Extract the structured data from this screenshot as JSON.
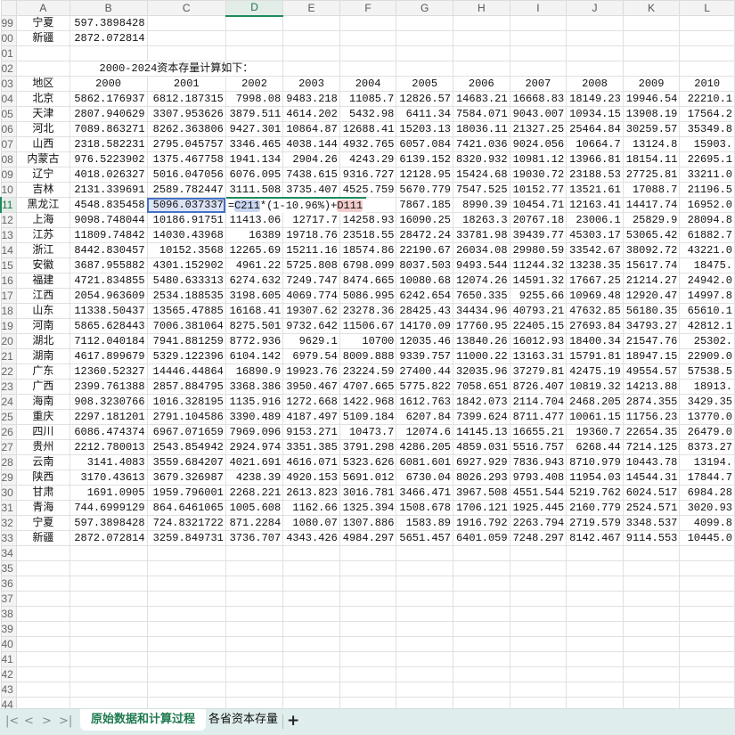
{
  "columns": [
    "A",
    "B",
    "C",
    "D",
    "E",
    "F",
    "G",
    "H",
    "I",
    "J",
    "K",
    "L"
  ],
  "active_column": "D",
  "active_row": "11",
  "rows": [
    {
      "n": "99",
      "cells": [
        "宁夏",
        "597.3898428"
      ]
    },
    {
      "n": "00",
      "cells": [
        "新疆",
        "2872.072814"
      ]
    },
    {
      "n": "01",
      "cells": []
    },
    {
      "n": "02",
      "title": "2000-2024资本存量计算如下："
    },
    {
      "n": "03",
      "cells": [
        "地区",
        "2000",
        "2001",
        "2002",
        "2003",
        "2004",
        "2005",
        "2006",
        "2007",
        "2008",
        "2009",
        "2010"
      ]
    },
    {
      "n": "04",
      "cells": [
        "北京",
        "5862.176937",
        "6812.187315",
        "7998.08",
        "9483.218",
        "11085.7",
        "12826.57",
        "14683.21",
        "16668.83",
        "18149.23",
        "19946.54",
        "22210.1"
      ]
    },
    {
      "n": "05",
      "cells": [
        "天津",
        "2807.940629",
        "3307.953626",
        "3879.511",
        "4614.202",
        "5432.98",
        "6411.34",
        "7584.071",
        "9043.007",
        "10934.15",
        "13908.19",
        "17564.2"
      ]
    },
    {
      "n": "06",
      "cells": [
        "河北",
        "7089.863271",
        "8262.363806",
        "9427.301",
        "10864.87",
        "12688.41",
        "15203.13",
        "18036.11",
        "21327.25",
        "25464.84",
        "30259.57",
        "35349.8"
      ]
    },
    {
      "n": "07",
      "cells": [
        "山西",
        "2318.582231",
        "2795.045757",
        "3346.465",
        "4038.144",
        "4932.765",
        "6057.084",
        "7421.036",
        "9024.056",
        "10664.7",
        "13124.8",
        "15903."
      ]
    },
    {
      "n": "08",
      "cells": [
        "内蒙古",
        "976.5223902",
        "1375.467758",
        "1941.134",
        "2904.26",
        "4243.29",
        "6139.152",
        "8320.932",
        "10981.12",
        "13966.81",
        "18154.11",
        "22695.1"
      ]
    },
    {
      "n": "09",
      "cells": [
        "辽宁",
        "4018.026327",
        "5016.047056",
        "6076.095",
        "7438.615",
        "9316.727",
        "12128.95",
        "15424.68",
        "19030.72",
        "23188.53",
        "27725.81",
        "33211.0"
      ]
    },
    {
      "n": "10",
      "cells": [
        "吉林",
        "2131.339691",
        "2589.782447",
        "3111.508",
        "3735.407",
        "4525.759",
        "5670.779",
        "7547.525",
        "10152.77",
        "13521.61",
        "17088.7",
        "21196.5"
      ]
    },
    {
      "n": "11",
      "cells": [
        "黑龙江",
        "4548.835458",
        "5096.037337",
        "",
        "",
        "",
        "7867.185",
        "8990.39",
        "10454.71",
        "12163.41",
        "14417.74",
        "16952.0"
      ]
    },
    {
      "n": "12",
      "cells": [
        "上海",
        "9098.748044",
        "10186.91751",
        "11413.06",
        "12717.7",
        "14258.93",
        "16090.25",
        "18263.3",
        "20767.18",
        "23006.1",
        "25829.9",
        "28094.8"
      ]
    },
    {
      "n": "13",
      "cells": [
        "江苏",
        "11809.74842",
        "14030.43968",
        "16389",
        "19718.76",
        "23518.55",
        "28472.24",
        "33781.98",
        "39439.77",
        "45303.17",
        "53065.42",
        "61882.7"
      ]
    },
    {
      "n": "14",
      "cells": [
        "浙江",
        "8442.830457",
        "10152.3568",
        "12265.69",
        "15211.16",
        "18574.86",
        "22190.67",
        "26034.08",
        "29980.59",
        "33542.67",
        "38092.72",
        "43221.0"
      ]
    },
    {
      "n": "15",
      "cells": [
        "安徽",
        "3687.955882",
        "4301.152902",
        "4961.22",
        "5725.808",
        "6798.099",
        "8037.503",
        "9493.544",
        "11244.32",
        "13238.35",
        "15617.74",
        "18475."
      ]
    },
    {
      "n": "16",
      "cells": [
        "福建",
        "4721.834855",
        "5480.633313",
        "6274.632",
        "7249.747",
        "8474.665",
        "10080.68",
        "12074.26",
        "14591.32",
        "17667.25",
        "21214.27",
        "24942.0"
      ]
    },
    {
      "n": "17",
      "cells": [
        "江西",
        "2054.963609",
        "2534.188535",
        "3198.605",
        "4069.774",
        "5086.995",
        "6242.654",
        "7650.335",
        "9255.66",
        "10969.48",
        "12920.47",
        "14997.8"
      ]
    },
    {
      "n": "18",
      "cells": [
        "山东",
        "11338.50437",
        "13565.47885",
        "16168.41",
        "19307.62",
        "23278.36",
        "28425.43",
        "34434.96",
        "40793.21",
        "47632.85",
        "56180.35",
        "65610.1"
      ]
    },
    {
      "n": "19",
      "cells": [
        "河南",
        "5865.628443",
        "7006.381064",
        "8275.501",
        "9732.642",
        "11506.67",
        "14170.09",
        "17760.95",
        "22405.15",
        "27693.84",
        "34793.27",
        "42812.1"
      ]
    },
    {
      "n": "20",
      "cells": [
        "湖北",
        "7112.040184",
        "7941.881259",
        "8772.936",
        "9629.1",
        "10700",
        "12035.46",
        "13840.26",
        "16012.93",
        "18400.34",
        "21547.76",
        "25302."
      ]
    },
    {
      "n": "21",
      "cells": [
        "湖南",
        "4617.899679",
        "5329.122396",
        "6104.142",
        "6979.54",
        "8009.888",
        "9339.757",
        "11000.22",
        "13163.31",
        "15791.81",
        "18947.15",
        "22909.0"
      ]
    },
    {
      "n": "22",
      "cells": [
        "广东",
        "12360.52327",
        "14446.44864",
        "16890.9",
        "19923.76",
        "23224.59",
        "27400.44",
        "32035.96",
        "37279.81",
        "42475.19",
        "49554.57",
        "57538.5"
      ]
    },
    {
      "n": "23",
      "cells": [
        "广西",
        "2399.761388",
        "2857.884795",
        "3368.386",
        "3950.467",
        "4707.665",
        "5775.822",
        "7058.651",
        "8726.407",
        "10819.32",
        "14213.88",
        "18913."
      ]
    },
    {
      "n": "24",
      "cells": [
        "海南",
        "908.3230766",
        "1016.328195",
        "1135.916",
        "1272.668",
        "1422.968",
        "1612.763",
        "1842.073",
        "2114.704",
        "2468.205",
        "2874.355",
        "3429.35"
      ]
    },
    {
      "n": "25",
      "cells": [
        "重庆",
        "2297.181201",
        "2791.104586",
        "3390.489",
        "4187.497",
        "5109.184",
        "6207.84",
        "7399.624",
        "8711.477",
        "10061.15",
        "11756.23",
        "13770.0"
      ]
    },
    {
      "n": "26",
      "cells": [
        "四川",
        "6086.474374",
        "6967.071659",
        "7969.096",
        "9153.271",
        "10473.7",
        "12074.6",
        "14145.13",
        "16655.21",
        "19360.7",
        "22654.35",
        "26479.0"
      ]
    },
    {
      "n": "27",
      "cells": [
        "贵州",
        "2212.780013",
        "2543.854942",
        "2924.974",
        "3351.385",
        "3791.298",
        "4286.205",
        "4859.031",
        "5516.757",
        "6268.44",
        "7214.125",
        "8373.27"
      ]
    },
    {
      "n": "28",
      "cells": [
        "云南",
        "3141.4083",
        "3559.684207",
        "4021.691",
        "4616.071",
        "5323.626",
        "6081.601",
        "6927.929",
        "7836.943",
        "8710.979",
        "10443.78",
        "13194."
      ]
    },
    {
      "n": "29",
      "cells": [
        "陕西",
        "3170.43613",
        "3679.326987",
        "4238.39",
        "4920.153",
        "5691.012",
        "6730.04",
        "8026.293",
        "9793.408",
        "11954.03",
        "14544.31",
        "17844.7"
      ]
    },
    {
      "n": "30",
      "cells": [
        "甘肃",
        "1691.0905",
        "1959.796001",
        "2268.221",
        "2613.823",
        "3016.781",
        "3466.471",
        "3967.508",
        "4551.544",
        "5219.762",
        "6024.517",
        "6984.28"
      ]
    },
    {
      "n": "31",
      "cells": [
        "青海",
        "744.6999129",
        "864.6461065",
        "1005.608",
        "1162.66",
        "1325.394",
        "1508.678",
        "1706.121",
        "1925.445",
        "2160.779",
        "2524.571",
        "3020.93"
      ]
    },
    {
      "n": "32",
      "cells": [
        "宁夏",
        "597.3898428",
        "724.8321722",
        "871.2284",
        "1080.07",
        "1307.886",
        "1583.89",
        "1916.792",
        "2263.794",
        "2719.579",
        "3348.537",
        "4099.8"
      ]
    },
    {
      "n": "33",
      "cells": [
        "新疆",
        "2872.072814",
        "3259.849731",
        "3736.707",
        "4343.426",
        "4984.297",
        "5651.457",
        "6401.059",
        "7248.297",
        "8142.467",
        "9114.553",
        "10445.0"
      ]
    },
    {
      "n": "34",
      "cells": []
    },
    {
      "n": "35",
      "cells": []
    },
    {
      "n": "36",
      "cells": []
    },
    {
      "n": "37",
      "cells": []
    },
    {
      "n": "38",
      "cells": []
    },
    {
      "n": "39",
      "cells": []
    },
    {
      "n": "40",
      "cells": []
    },
    {
      "n": "41",
      "cells": []
    },
    {
      "n": "42",
      "cells": []
    },
    {
      "n": "43",
      "cells": []
    },
    {
      "n": "44",
      "cells": []
    }
  ],
  "editing": {
    "row": "11",
    "col": "D",
    "parts": [
      "=",
      "C211",
      "*(1-10.96%)+",
      "D111"
    ]
  },
  "selected_cell": {
    "row": "11",
    "col": "C"
  },
  "colors": {
    "accent": "#1e8a5a",
    "selection": "#4472c4",
    "ref1": "#c9d6f2",
    "ref2": "#f4cccc"
  },
  "sheet_tabs": {
    "nav_icons": [
      "first-sheet-icon",
      "prev-sheet-icon",
      "next-sheet-icon",
      "last-sheet-icon"
    ],
    "nav_glyphs": [
      "|<",
      "<",
      ">",
      ">|"
    ],
    "tabs": [
      {
        "label": "原始数据和计算过程",
        "active": true
      },
      {
        "label": "各省资本存量",
        "active": false
      }
    ],
    "add_label": "+"
  }
}
